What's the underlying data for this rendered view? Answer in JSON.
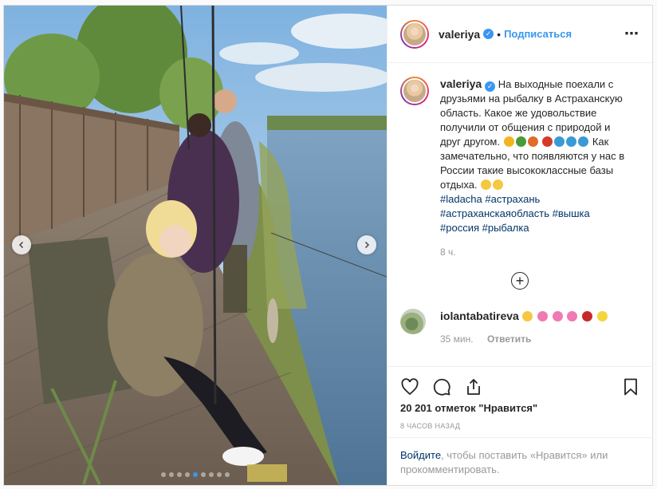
{
  "post": {
    "author": "valeriya",
    "follow_label": "Подписаться",
    "separator": "•",
    "more_label": "•••"
  },
  "caption": {
    "username": "valeriya",
    "text_1": "На выходные поехали с друзьями на рыбалку в Астраханскую область. Какое же удовольствие получили от общения с природой и друг другом.",
    "text_2": "Как замечательно, что появляются у нас в России такие высококлассные базы отдыха.",
    "hashtags": [
      "#ladacha",
      "#астрахань",
      "#астраханскаяобласть",
      "#вышка",
      "#россия",
      "#рыбалка"
    ],
    "time": "8 ч."
  },
  "comment": {
    "username": "iolantabatireva",
    "time": "35 мин.",
    "reply_label": "Ответить"
  },
  "likes": "20 201 отметок \"Нравится\"",
  "posted_ago": "8 ЧАСОВ НАЗАД",
  "login_prompt": {
    "link": "Войдите",
    "rest": ", чтобы поставить «Нравится» или прокомментировать."
  },
  "carousel": {
    "slide_count": 9,
    "active_index": 4
  },
  "colors": {
    "accent": "#3897f0",
    "hashtag": "#003569"
  },
  "icons": [
    "verified-badge-icon",
    "more-options-icon",
    "chevron-left-icon",
    "chevron-right-icon",
    "load-more-icon",
    "heart-icon",
    "comment-icon",
    "share-icon",
    "bookmark-icon"
  ]
}
